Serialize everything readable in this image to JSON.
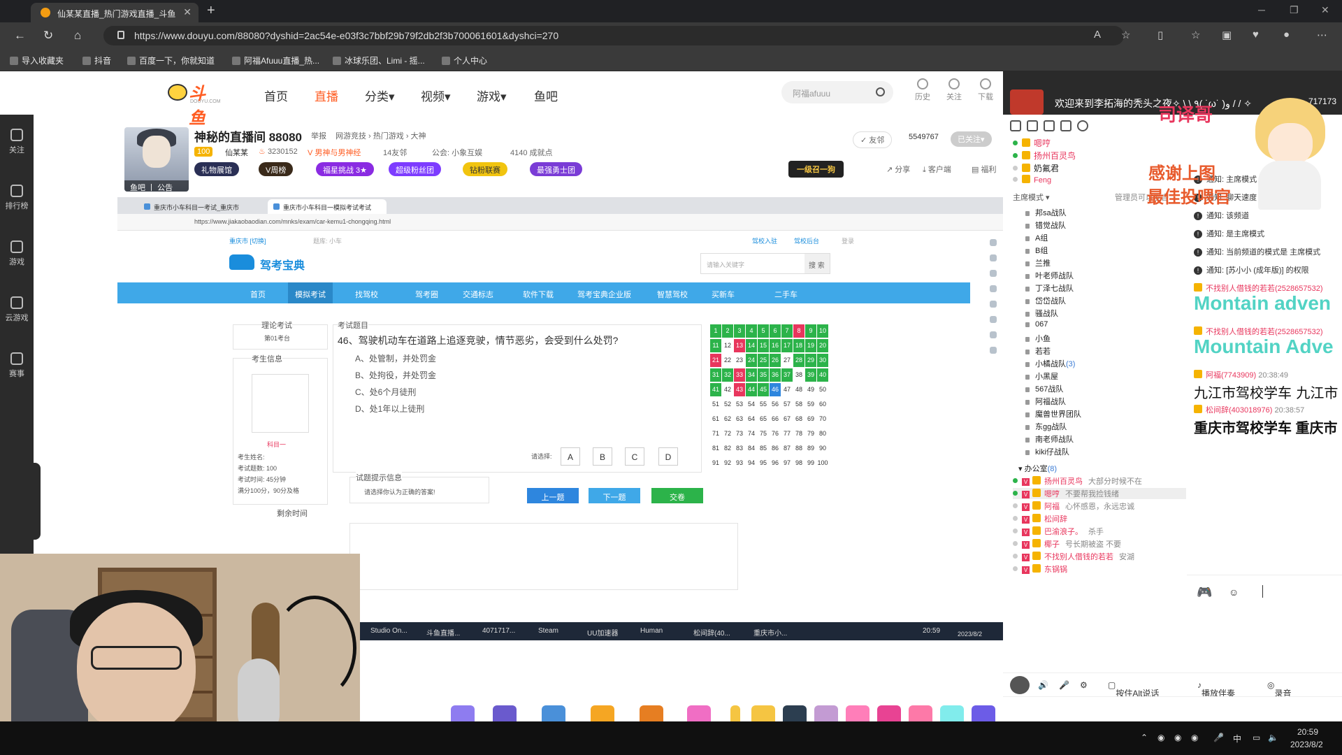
{
  "browser": {
    "tab_title": "仙某某直播_热门游戏直播_斗鱼",
    "url": "https://www.douyu.com/88080?dyshid=2ac54e-e03f3c7bbf29b79f2db2f3b700061601&dyshci=270",
    "bookmarks": [
      "导入收藏夹",
      "抖音",
      "百度一下，你就知道",
      "阿福Afuuu直播_热...",
      "冰球乐团、Limi - 摇...",
      "个人中心"
    ]
  },
  "site": {
    "logo": "斗鱼",
    "logo_sub": "DOUYU.COM",
    "nav": [
      "首页",
      "直播",
      "分类",
      "视频",
      "游戏",
      "鱼吧"
    ],
    "search_placeholder": "阿福afuuu",
    "header_icons": [
      "历史",
      "关注",
      "下载"
    ]
  },
  "sidebar": [
    "关注",
    "排行榜",
    "游戏",
    "云游戏",
    "赛事"
  ],
  "room": {
    "title": "神秘的直播间 88080",
    "report": "举报",
    "category": "网游竞技 › 热门游戏 › 大神",
    "level": "100",
    "streamer": "仙某某",
    "heat": "3230152",
    "tag": "男神与男神经",
    "neighbors": "14友邻",
    "guild": "公会: 小象互娱",
    "achieve": "4140 成就点",
    "avatar_foot": "鱼吧 丨 公告",
    "pills": [
      "礼物展馆",
      "V周榜",
      "福星挑战 3★",
      "超级粉丝团",
      "钻粉联赛",
      "最强勇士团"
    ],
    "follow": "友邻",
    "follow_count": "5549767",
    "followed": "已关注",
    "badge": "一级召一狗",
    "actions": [
      "分享",
      "客户端",
      "福利"
    ]
  },
  "share": {
    "tabs": [
      "重庆市小车科目一考试_重庆市",
      "重庆市小车科目一模拟考试考试"
    ],
    "url": "https://www.jiakaobaodian.com/mnks/exam/car-kemu1-chongqing.html",
    "city": "重庆市 [切换]",
    "bank": "题库: 小车",
    "toplinks": [
      "驾校入驻",
      "驾校后台",
      "登录"
    ],
    "brand": "驾考宝典",
    "search_placeholder": "请输入关键字",
    "search_btn": "搜 索",
    "nav": [
      "首页",
      "模拟考试",
      "找驾校",
      "驾考圈",
      "交通标志",
      "软件下载",
      "驾考宝典企业版",
      "智慧驾校",
      "买新车",
      "二手车"
    ],
    "exam_label": "理论考试",
    "exam_seat": "第01考台",
    "examinee_label": "考生信息",
    "subject": "科目一",
    "info": [
      "考生姓名:",
      "考试题数: 100",
      "考试时间: 45分钟",
      "满分100分，90分及格"
    ],
    "remain": "剩余时间",
    "question_label": "考试题目",
    "question": "46、驾驶机动车在道路上追逐竞驶，情节恶劣，会受到什么处罚?",
    "options": [
      "A、处管制，并处罚金",
      "B、处拘役，并处罚金",
      "C、处6个月徒刑",
      "D、处1年以上徒刑"
    ],
    "choose": "请选择:",
    "answers": [
      "A",
      "B",
      "C",
      "D"
    ],
    "hint_label": "试题提示信息",
    "hint": "请选择你认为正确的答案!",
    "buttons": [
      "上一题",
      "下一题",
      "交卷"
    ],
    "taskbar": [
      "Studio On...",
      "斗鱼直播...",
      "4071717...",
      "Steam",
      "UU加速器",
      "Human",
      "松间辞(40...",
      "重庆市小..."
    ],
    "clock": "20:59",
    "date": "2023/8/2"
  },
  "grid": {
    "green": [
      1,
      2,
      3,
      4,
      5,
      6,
      7,
      9,
      10,
      11,
      14,
      15,
      16,
      17,
      18,
      19,
      20,
      24,
      25,
      26,
      28,
      29,
      30,
      31,
      32,
      34,
      35,
      36,
      37,
      39,
      40,
      41,
      44,
      45
    ],
    "red": [
      8,
      13,
      21,
      33,
      43
    ],
    "blue": [
      46
    ]
  },
  "chat": {
    "welcome": "欢迎来到李拓海的秃头之夜✧ \\ \\ ٩( ˙ω˙ )و / / ✧",
    "count": "717173",
    "deco1": "司译哥",
    "deco2": "感谢上图",
    "deco3": "最佳投喂官",
    "mode": "主席模式",
    "admin_note": "管理员可以发言",
    "members_top": [
      "嗯哼",
      "扬州百灵鸟",
      "奶氟君",
      "Feng"
    ],
    "groups": [
      "邦sa战队",
      "错觉战队",
      "A组",
      "B组",
      "兰推",
      "叶老师战队",
      "丁泽七战队",
      "岱岱战队",
      "骚战队",
      "067",
      "小鱼",
      "若若",
      "小橘战队",
      "小黑屋",
      "567战队",
      "阿福战队",
      "魔兽世界团队",
      "东gg战队",
      "南老师战队",
      "kiki仔战队"
    ],
    "group_count": "(3)",
    "office": "办公室",
    "office_count": "(8)",
    "office_members": [
      {
        "name": "扬州百灵鸟",
        "status": "大部分时候不在"
      },
      {
        "name": "嗯哼",
        "status": "不要帮我捡钱绪"
      },
      {
        "name": "阿福",
        "status": "心怀感恩，永远忠诚"
      },
      {
        "name": "松间辞",
        "status": ""
      },
      {
        "name": "巴渝浪子。",
        "status": "杀手"
      },
      {
        "name": "椰子",
        "status": "号长期被盗 不要"
      },
      {
        "name": "不找别人借钱的若若",
        "status": "安湖"
      },
      {
        "name": "东锅锅",
        "status": ""
      }
    ],
    "notices": [
      "通知: 主席模式",
      "通知: 聊天速度",
      "通知: 该频道",
      "通知: 是主席模式",
      "通知: 当前频道的模式是 主席模式"
    ],
    "notice_partial": [
      "通知: [苏小小 (成年版)] 的权限"
    ],
    "gift_user1": "不找别人借钱的若若(2528657532)",
    "big1": "Montain adven",
    "gift_user2": "不找别人借钱的若若(2528657532)",
    "big2": "Mountain Adve",
    "user3": "阿福(7743909)",
    "time3": "20:38:49",
    "msg3": "九江市驾校学车 九江市",
    "user4": "松间辞(403018976)",
    "time4": "20:38:57",
    "msg4": "重庆市驾校学车 重庆市",
    "controls": [
      "按住Alt说话",
      "播放伴奏",
      "录音"
    ]
  },
  "taskbar": {
    "ime": "中",
    "clock": "20:59",
    "date": "2023/8/2"
  }
}
